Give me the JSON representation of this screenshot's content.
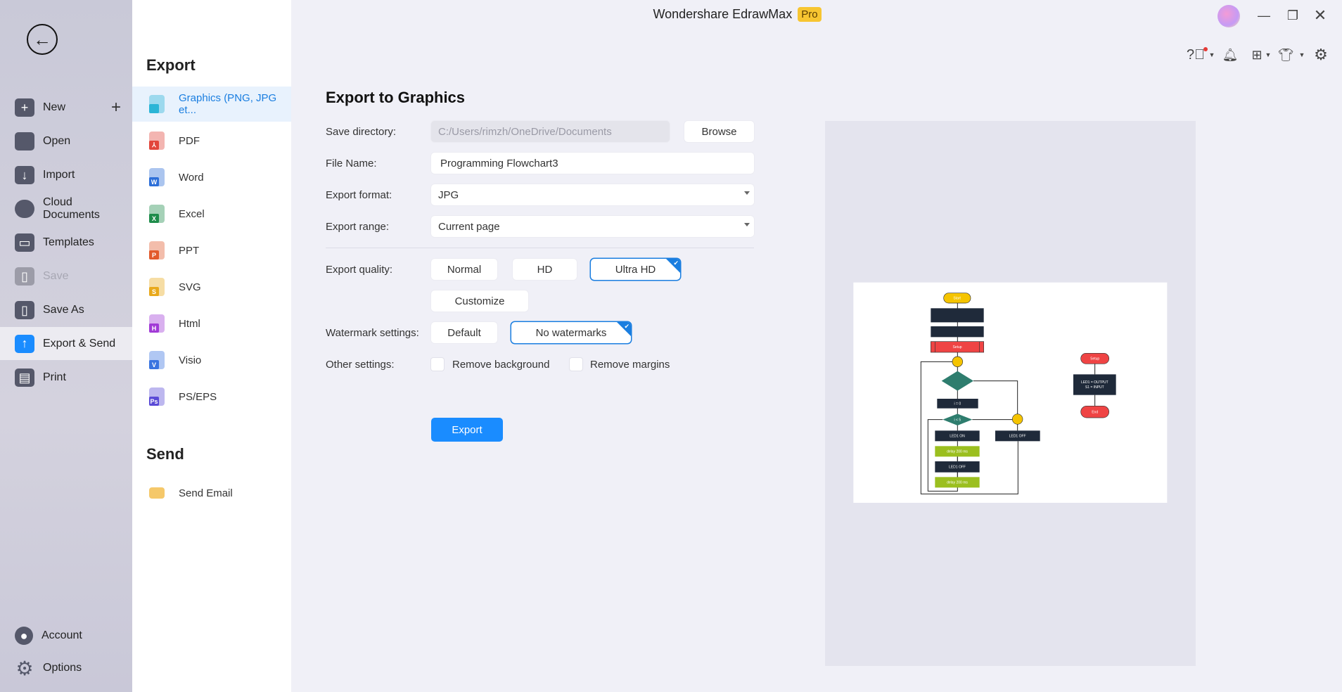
{
  "app": {
    "title": "Wondershare EdrawMax",
    "badge": "Pro"
  },
  "colors": {
    "accent": "#1a8cff",
    "badge": "#f7c531",
    "preview_bg": "#e4e4ee"
  },
  "sidebar": {
    "items": [
      {
        "label": "New",
        "icon": "plus-square-icon"
      },
      {
        "label": "Open",
        "icon": "folder-icon"
      },
      {
        "label": "Import",
        "icon": "import-icon"
      },
      {
        "label": "Cloud Documents",
        "icon": "cloud-icon"
      },
      {
        "label": "Templates",
        "icon": "templates-icon"
      },
      {
        "label": "Save",
        "icon": "save-icon",
        "disabled": true
      },
      {
        "label": "Save As",
        "icon": "save-as-icon"
      },
      {
        "label": "Export & Send",
        "icon": "export-icon",
        "active": true
      },
      {
        "label": "Print",
        "icon": "print-icon"
      }
    ],
    "bottom": [
      {
        "label": "Account",
        "icon": "account-icon"
      },
      {
        "label": "Options",
        "icon": "gear-icon"
      }
    ]
  },
  "export_menu": {
    "heading": "Export",
    "items": [
      {
        "label": "Graphics (PNG, JPG et...",
        "color": "#2bb5d6",
        "letter": ""
      },
      {
        "label": "PDF",
        "color": "#e2463b",
        "letter": "⅄"
      },
      {
        "label": "Word",
        "color": "#2d6fd8",
        "letter": "W"
      },
      {
        "label": "Excel",
        "color": "#1e8c4a",
        "letter": "X"
      },
      {
        "label": "PPT",
        "color": "#e25a2c",
        "letter": "P"
      },
      {
        "label": "SVG",
        "color": "#e8a91c",
        "letter": "S"
      },
      {
        "label": "Html",
        "color": "#a13ad6",
        "letter": "H"
      },
      {
        "label": "Visio",
        "color": "#3a74e0",
        "letter": "V"
      },
      {
        "label": "PS/EPS",
        "color": "#5a4ad6",
        "letter": "Ps"
      }
    ],
    "send_heading": "Send",
    "send_items": [
      {
        "label": "Send Email"
      }
    ]
  },
  "form": {
    "title": "Export to Graphics",
    "save_directory": {
      "label": "Save directory:",
      "value": "C:/Users/rimzh/OneDrive/Documents",
      "browse": "Browse"
    },
    "file_name": {
      "label": "File Name:",
      "value": "Programming Flowchart3"
    },
    "export_format": {
      "label": "Export format:",
      "value": "JPG"
    },
    "export_range": {
      "label": "Export range:",
      "value": "Current page"
    },
    "quality": {
      "label": "Export quality:",
      "options": [
        "Normal",
        "HD",
        "Ultra HD"
      ],
      "selected": "Ultra HD",
      "customize": "Customize"
    },
    "watermark": {
      "label": "Watermark settings:",
      "options": [
        "Default",
        "No watermarks"
      ],
      "selected": "No watermarks"
    },
    "other": {
      "label": "Other settings:",
      "remove_background": "Remove background",
      "remove_margins": "Remove margins",
      "remove_background_checked": false,
      "remove_margins_checked": false
    },
    "export_button": "Export"
  },
  "preview": {
    "labels": {
      "start": "Start",
      "setup": "Setup",
      "i0": "i = 0",
      "i5": "i < 5",
      "led_on": "LED1 ON",
      "delay1": "delay 200 ms",
      "led_off": "LED1 OFF",
      "delay2": "delay 200 ms",
      "led_off_right": "LED1 OFF",
      "setup_right": "Setup",
      "io": "LED1 = OUTPUT",
      "io2": "S1 = INPUT",
      "end": "End"
    }
  }
}
